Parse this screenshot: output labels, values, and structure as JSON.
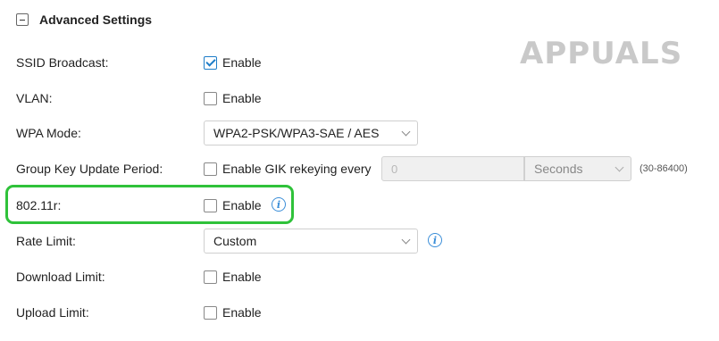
{
  "section": {
    "title": "Advanced Settings"
  },
  "rows": {
    "ssid": {
      "label": "SSID Broadcast:",
      "checkbox_label": "Enable",
      "checked": true
    },
    "vlan": {
      "label": "VLAN:",
      "checkbox_label": "Enable",
      "checked": false
    },
    "wpa": {
      "label": "WPA Mode:",
      "value": "WPA2-PSK/WPA3-SAE / AES"
    },
    "gik": {
      "label": "Group Key Update Period:",
      "checkbox_label": "Enable GIK rekeying every",
      "checked": false,
      "input_value": "0",
      "unit_value": "Seconds",
      "range_hint": "(30-86400)"
    },
    "r80211": {
      "label": "802.11r:",
      "checkbox_label": "Enable",
      "checked": false
    },
    "rate": {
      "label": "Rate Limit:",
      "value": "Custom"
    },
    "download": {
      "label": "Download Limit:",
      "checkbox_label": "Enable",
      "checked": false
    },
    "upload": {
      "label": "Upload Limit:",
      "checkbox_label": "Enable",
      "checked": false
    }
  },
  "icons": {
    "info": "i"
  },
  "watermark": {
    "text": "APPUALS"
  },
  "colors": {
    "accent": "#1e7dc8",
    "highlight": "#2fc23a"
  }
}
